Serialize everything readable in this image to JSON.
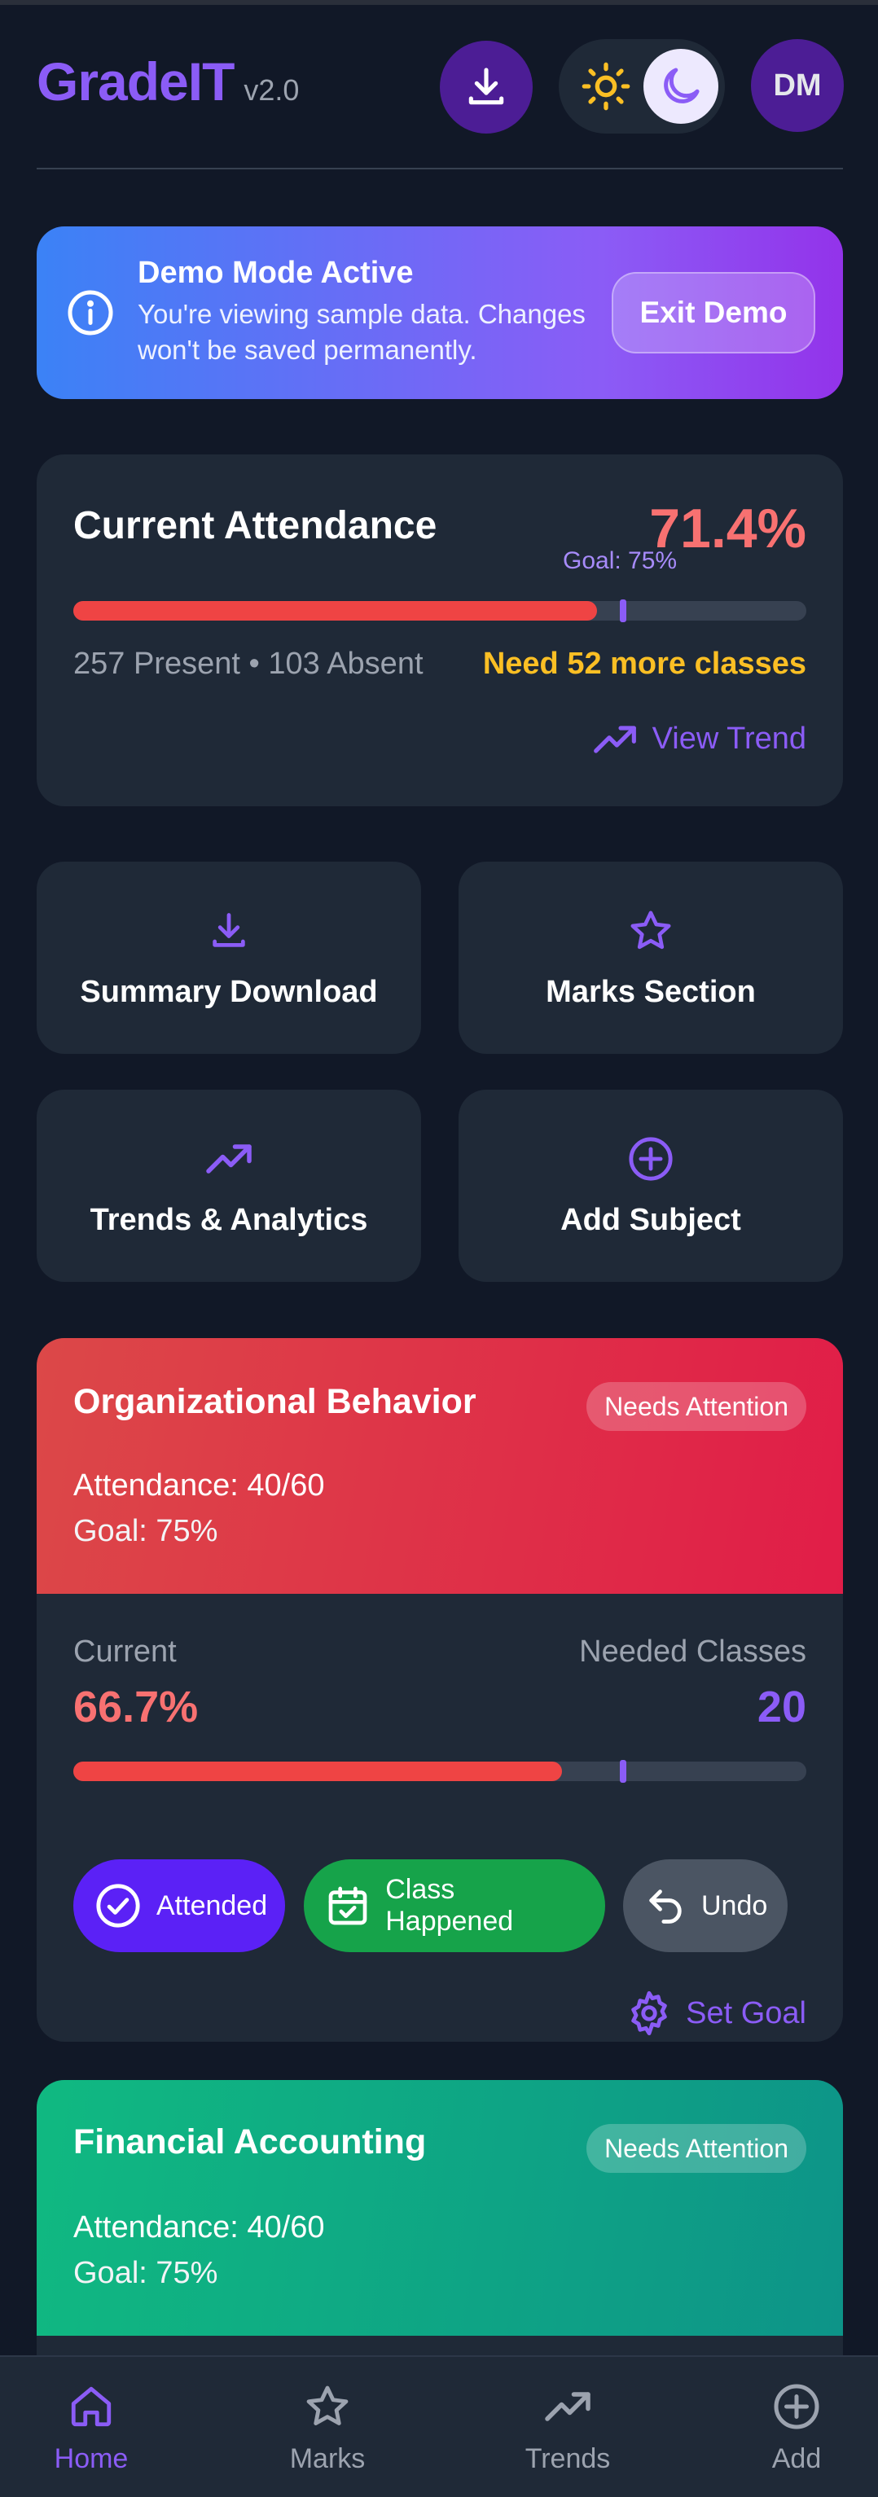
{
  "header": {
    "brand": "GradeIT",
    "version": "v2.0",
    "avatar_initials": "DM"
  },
  "demo_banner": {
    "title": "Demo Mode Active",
    "text": "You're viewing sample data. Changes won't be saved permanently.",
    "exit_label": "Exit Demo"
  },
  "attendance": {
    "label": "Current Attendance",
    "percent_text": "71.4%",
    "percent": 71.4,
    "goal_text": "Goal: 75%",
    "goal": 75,
    "counts": "257 Present • 103 Absent",
    "need_text": "Need 52 more classes",
    "trend_label": "View Trend"
  },
  "actions": [
    {
      "label": "Summary Download",
      "icon": "download-icon"
    },
    {
      "label": "Marks Section",
      "icon": "star-icon"
    },
    {
      "label": "Trends & Analytics",
      "icon": "trending-up-icon"
    },
    {
      "label": "Add Subject",
      "icon": "plus-circle-icon"
    }
  ],
  "subjects": [
    {
      "name": "Organizational Behavior",
      "badge": "Needs Attention",
      "attendance_text": "Attendance: 40/60",
      "goal_text": "Goal: 75%",
      "current_label": "Current",
      "current_value": "66.7%",
      "current_percent": 66.7,
      "goal_percent": 75,
      "needed_label": "Needed Classes",
      "needed_value": "20",
      "attended_label": "Attended",
      "happened_label": "Class Happened",
      "undo_label": "Undo",
      "set_goal_label": "Set Goal"
    },
    {
      "name": "Financial Accounting",
      "badge": "Needs Attention",
      "attendance_text": "Attendance: 40/60",
      "goal_text": "Goal: 75%"
    }
  ],
  "nav": [
    {
      "label": "Home",
      "icon": "home-icon",
      "active": true
    },
    {
      "label": "Marks",
      "icon": "star-icon",
      "active": false
    },
    {
      "label": "Trends",
      "icon": "trending-up-icon",
      "active": false
    },
    {
      "label": "Add",
      "icon": "plus-circle-icon",
      "active": false
    }
  ],
  "colors": {
    "accent": "#8b5cf6",
    "danger": "#ef4444",
    "warning": "#fbbf24",
    "attended": "#5b21f6",
    "happened": "#16a34a",
    "card": "#1f2937",
    "background": "#111827"
  }
}
